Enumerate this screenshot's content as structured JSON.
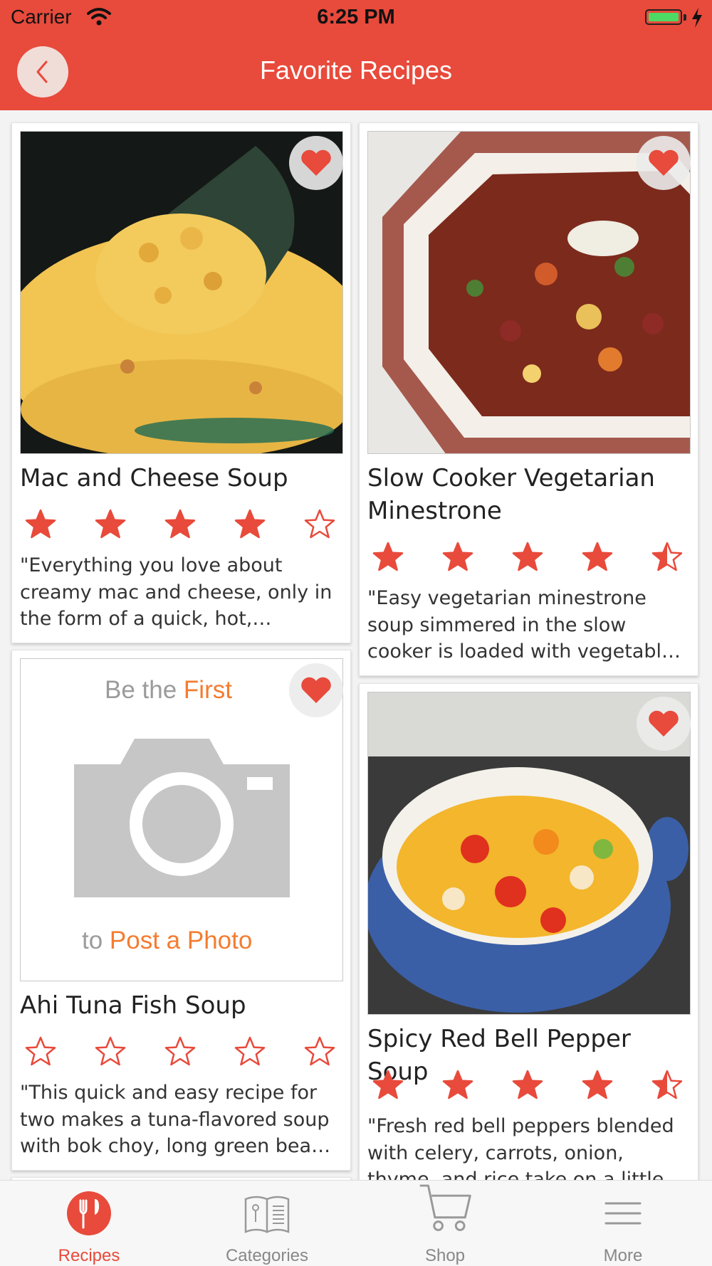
{
  "status_bar": {
    "carrier": "Carrier",
    "time": "6:25 PM"
  },
  "nav": {
    "title": "Favorite Recipes"
  },
  "colors": {
    "accent": "#e84a3b",
    "star": "#e84a3b"
  },
  "recipes": [
    {
      "title": "Mac and Cheese Soup",
      "rating": 4,
      "description": "\"Everything you love about creamy mac and cheese, only in the form of a quick, hot, comforting soup.\"",
      "photo": "mac-and-cheese-photo",
      "favorite": true
    },
    {
      "title": "Slow Cooker Vegetarian Minestrone",
      "rating": 4.5,
      "description": "\"Easy vegetarian minestrone soup simmered in the slow cooker is loaded with vegetables and macaroni.\"",
      "photo": "minestrone-photo",
      "favorite": true
    },
    {
      "title": "Ahi Tuna Fish Soup",
      "rating": 0,
      "description": "\"This quick and easy recipe for two makes a tuna-flavored soup with bok choy, long green beans and noodles.\"",
      "photo": "placeholder",
      "placeholder": {
        "line1_prefix": "Be the ",
        "line1_highlight": "First",
        "line2_prefix": "to ",
        "line2_highlight": "Post a Photo"
      },
      "favorite": true
    },
    {
      "title": "Spicy Red Bell Pepper Soup",
      "rating": 4.5,
      "description": "\"Fresh red bell peppers blended with celery, carrots, onion, thyme, and rice take on a little heat from crushed red pepper.\"",
      "photo": "bell-pepper-photo",
      "favorite": true
    }
  ],
  "tabs": [
    {
      "label": "Recipes",
      "icon": "fork-knife-icon",
      "active": true
    },
    {
      "label": "Categories",
      "icon": "book-icon",
      "active": false
    },
    {
      "label": "Shop",
      "icon": "cart-icon",
      "active": false
    },
    {
      "label": "More",
      "icon": "menu-icon",
      "active": false
    }
  ]
}
